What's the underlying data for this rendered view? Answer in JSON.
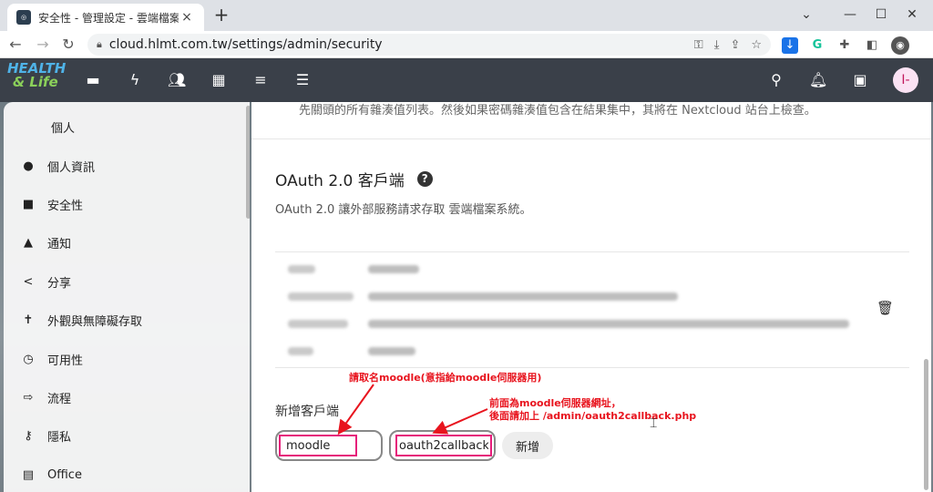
{
  "browser": {
    "tab_title": "安全性 - 管理設定 - 雲端檔案系統",
    "tab_close": "×",
    "new_tab": "+",
    "window_controls": [
      "⌄",
      "—",
      "☐",
      "✕"
    ],
    "nav": {
      "back": "←",
      "forward": "→",
      "reload": "↻"
    },
    "url": "cloud.hlmt.com.tw/settings/admin/security",
    "omnibox_icons": [
      "key-icon",
      "install-icon",
      "share-icon",
      "star-icon"
    ],
    "extension_icons": [
      "download-ext-icon",
      "grammarly-icon",
      "puzzle-icon",
      "sidepanel-icon",
      "profile-icon"
    ]
  },
  "header": {
    "logo_line1": "HEALTH",
    "logo_line2": "& Life",
    "apps": [
      "files-icon",
      "activity-icon",
      "contacts-icon",
      "calendar-icon",
      "deck-icon",
      "tasks-icon"
    ],
    "right": [
      "search-icon",
      "notifications-icon",
      "contacts-menu-icon"
    ],
    "avatar": "I-"
  },
  "sidebar": {
    "section": "個人",
    "items": [
      {
        "icon": "person-icon",
        "label": "個人資訊"
      },
      {
        "icon": "lock-icon",
        "label": "安全性"
      },
      {
        "icon": "bell-icon",
        "label": "通知"
      },
      {
        "icon": "share-icon",
        "label": "分享"
      },
      {
        "icon": "accessibility-icon",
        "label": "外觀與無障礙存取"
      },
      {
        "icon": "clock-icon",
        "label": "可用性"
      },
      {
        "icon": "flow-icon",
        "label": "流程"
      },
      {
        "icon": "key-icon",
        "label": "隱私"
      },
      {
        "icon": "document-icon",
        "label": "Office"
      }
    ]
  },
  "main": {
    "top_cut_text": "先關頭的所有雜湊值列表。然後如果密碼雜湊值包含在結果集中，其將在 Nextcloud 站台上檢查。",
    "oauth_title": "OAuth 2.0 客戶端",
    "help": "?",
    "oauth_desc": "OAuth 2.0 讓外部服務請求存取 雲端檔案系統。",
    "new_client_label": "新增客戶端",
    "name_value": "moodle",
    "redirect_value": "oauth2callback.",
    "add_button": "新增"
  },
  "annotations": {
    "note1": "請取名moodle(意指給moodle伺服器用)",
    "note2_line1": "前面為moodle伺服器網址，",
    "note2_line2": "後面請加上 /admin/oauth2callback.php"
  },
  "colors": {
    "accent": "#e61c7a",
    "annotation": "#e8141e",
    "header": "#3a4049"
  }
}
